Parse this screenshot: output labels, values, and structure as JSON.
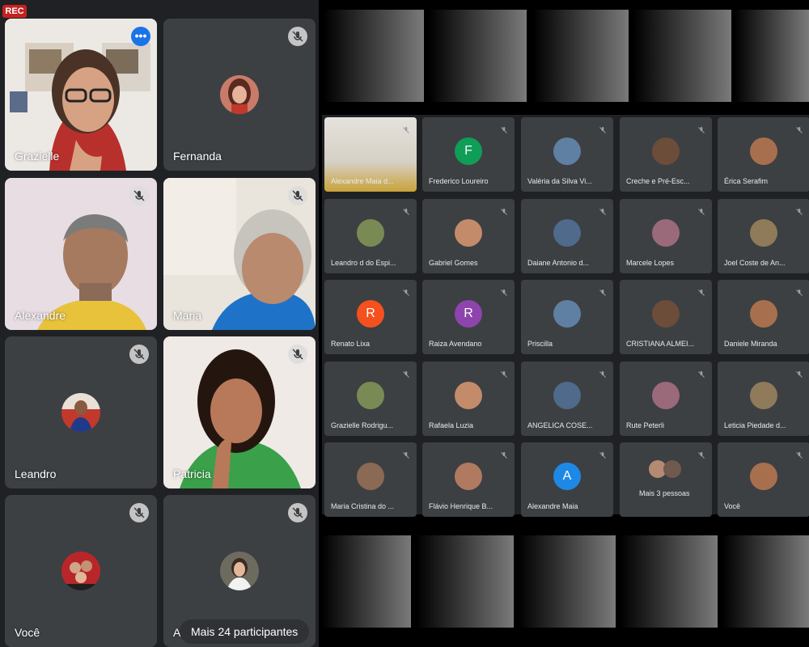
{
  "recording": {
    "label": "REC"
  },
  "left_tiles": [
    {
      "name": "Grazielle",
      "muted": false
    },
    {
      "name": "Fernanda",
      "muted": true
    },
    {
      "name": "Alexandre",
      "muted": true
    },
    {
      "name": "Maria",
      "muted": true
    },
    {
      "name": "Leandro",
      "muted": true
    },
    {
      "name": "Patricia",
      "muted": true
    },
    {
      "name": "Você",
      "muted": true
    },
    {
      "name": "A",
      "muted": true
    }
  ],
  "more_participants": {
    "label": "Mais 24 participantes"
  },
  "grid_tiles": [
    {
      "name": "Alexandre Maia d...",
      "initial": "",
      "color": ""
    },
    {
      "name": "Frederico Loureiro",
      "initial": "F",
      "color": "#0f9d58"
    },
    {
      "name": "Valéria da Silva Vi...",
      "initial": "",
      "color": ""
    },
    {
      "name": "Creche e Pré-Esc...",
      "initial": "",
      "color": ""
    },
    {
      "name": "Érica Serafim",
      "initial": "",
      "color": ""
    },
    {
      "name": "Leandro d do Espi...",
      "initial": "",
      "color": ""
    },
    {
      "name": "Gabriel Gomes",
      "initial": "",
      "color": ""
    },
    {
      "name": "Daiane Antonio d...",
      "initial": "",
      "color": ""
    },
    {
      "name": "Marcele Lopes",
      "initial": "",
      "color": ""
    },
    {
      "name": "Joel Coste de An...",
      "initial": "",
      "color": ""
    },
    {
      "name": "Renato Lixa",
      "initial": "R",
      "color": "#f4511e"
    },
    {
      "name": "Raiza Avendano",
      "initial": "R",
      "color": "#8e44ad"
    },
    {
      "name": "Priscilla",
      "initial": "",
      "color": ""
    },
    {
      "name": "CRISTIANA ALMEI...",
      "initial": "",
      "color": ""
    },
    {
      "name": "Daniele Miranda",
      "initial": "",
      "color": ""
    },
    {
      "name": "Grazielle Rodrigu...",
      "initial": "",
      "color": ""
    },
    {
      "name": "Rafaela Luzia",
      "initial": "",
      "color": ""
    },
    {
      "name": "ANGELICA COSE...",
      "initial": "",
      "color": ""
    },
    {
      "name": "Rute Peterli",
      "initial": "",
      "color": ""
    },
    {
      "name": "Leticia Piedade d...",
      "initial": "",
      "color": ""
    },
    {
      "name": "Maria Cristina do ...",
      "initial": "",
      "color": ""
    },
    {
      "name": "Flávio Henrique B...",
      "initial": "",
      "color": ""
    },
    {
      "name": "Alexandre Maia",
      "initial": "A",
      "color": "#1e88e5"
    },
    {
      "name": "Mais 3 pessoas",
      "initial": "",
      "color": ""
    },
    {
      "name": "Você",
      "initial": "",
      "color": ""
    }
  ]
}
